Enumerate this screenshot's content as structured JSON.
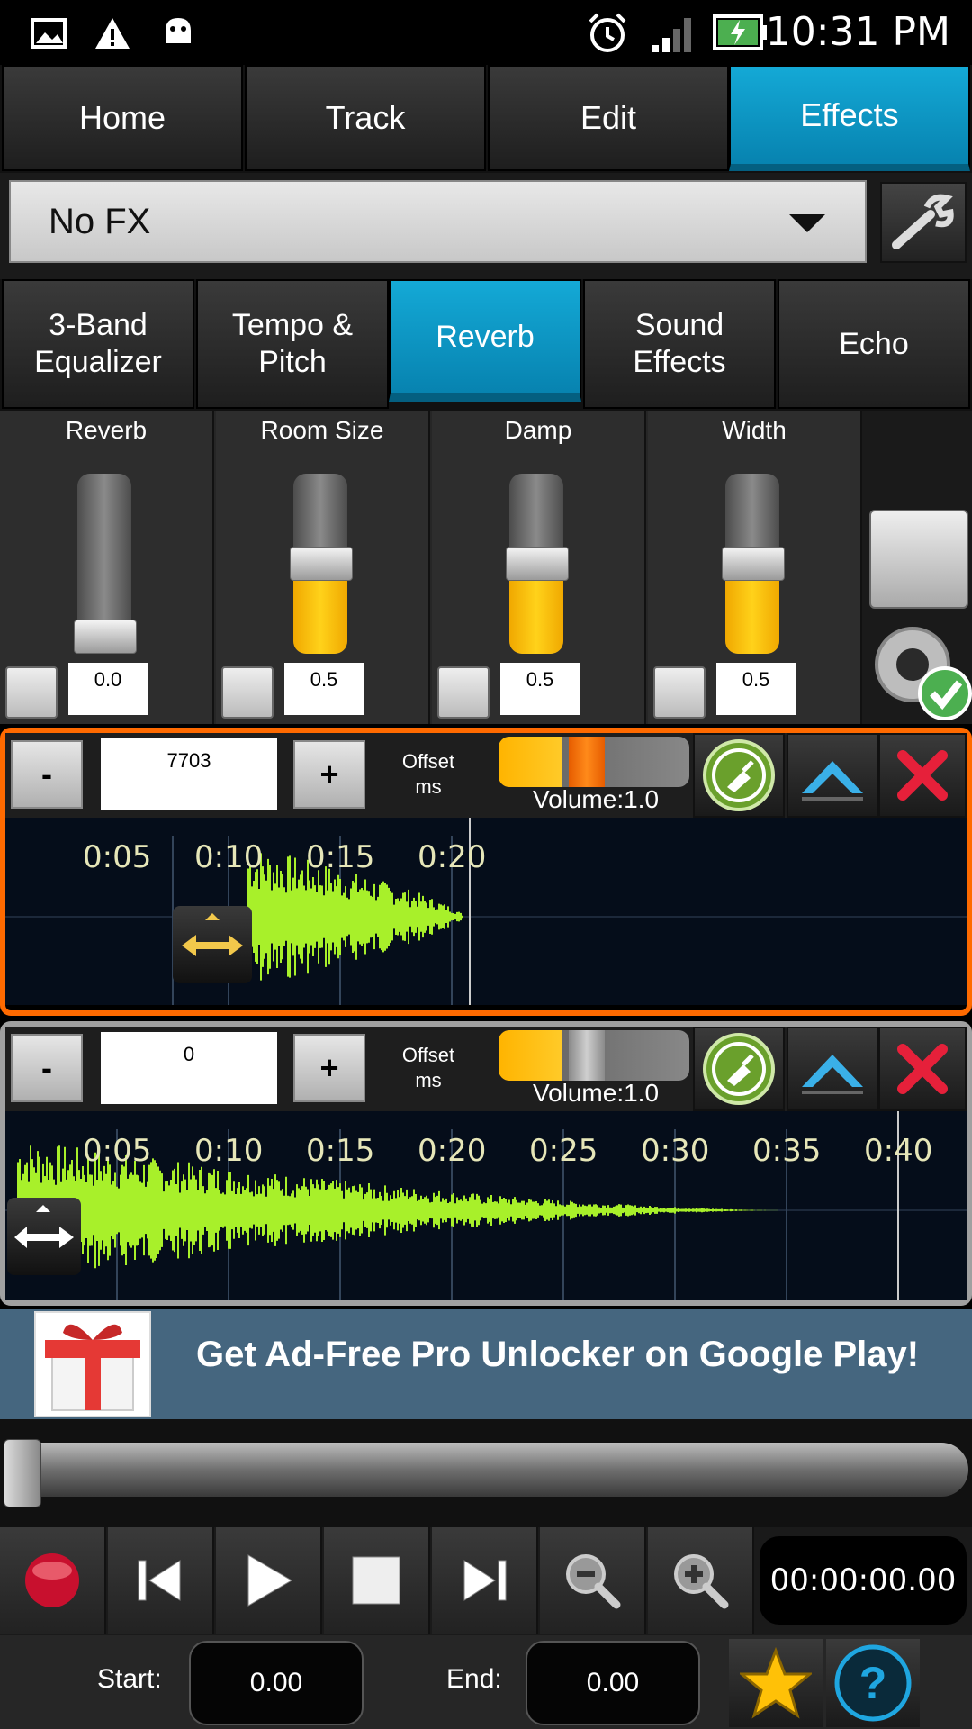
{
  "status_bar": {
    "time": "10:31 PM",
    "icons": [
      "gallery-icon",
      "warning-icon",
      "android-icon",
      "alarm-icon",
      "signal-icon",
      "battery-charging-icon"
    ]
  },
  "main_tabs": [
    {
      "label": "Home",
      "active": false
    },
    {
      "label": "Track",
      "active": false
    },
    {
      "label": "Edit",
      "active": false
    },
    {
      "label": "Effects",
      "active": true
    }
  ],
  "fx_selector": {
    "value": "No FX",
    "settings_icon": "wrench-icon"
  },
  "effect_tabs": [
    {
      "line1": "3-Band",
      "line2": "Equalizer",
      "active": false
    },
    {
      "line1": "Tempo &",
      "line2": "Pitch",
      "active": false
    },
    {
      "line1": "Reverb",
      "line2": "",
      "active": true
    },
    {
      "line1": "Sound",
      "line2": "Effects",
      "active": false
    },
    {
      "line1": "Echo",
      "line2": "",
      "active": false
    }
  ],
  "reverb_sliders": [
    {
      "label": "Reverb",
      "value": "0.0",
      "level": 0.0
    },
    {
      "label": "Room Size",
      "value": "0.5",
      "level": 0.5
    },
    {
      "label": "Damp",
      "value": "0.5",
      "level": 0.5
    },
    {
      "label": "Width",
      "value": "0.5",
      "level": 0.5
    }
  ],
  "tracks": [
    {
      "minus": "-",
      "plus": "+",
      "offset_value": "7703",
      "offset_label_1": "Offset",
      "offset_label_2": "ms",
      "volume_label": "Volume:1.0",
      "volume_level": 0.4,
      "selected": true,
      "ticks": [
        "0:05",
        "0:10",
        "0:15",
        "0:20"
      ]
    },
    {
      "minus": "-",
      "plus": "+",
      "offset_value": "0",
      "offset_label_1": "Offset",
      "offset_label_2": "ms",
      "volume_label": "Volume:1.0",
      "volume_level": 0.4,
      "selected": false,
      "ticks": [
        "0:05",
        "0:10",
        "0:15",
        "0:20",
        "0:25",
        "0:30",
        "0:35",
        "0:40"
      ]
    }
  ],
  "ad": {
    "text": "Get Ad-Free Pro Unlocker on Google Play!"
  },
  "seek": {
    "position": 0.0
  },
  "transport": {
    "time": "00:00:00.00"
  },
  "selection": {
    "start_label": "Start:",
    "start_value": "0.00",
    "end_label": "End:",
    "end_value": "0.00"
  },
  "colors": {
    "accent": "#0a97c6",
    "waveform": "#a8f02a",
    "selected_border": "#ff6a00",
    "slider_fill": "#ffc107"
  }
}
